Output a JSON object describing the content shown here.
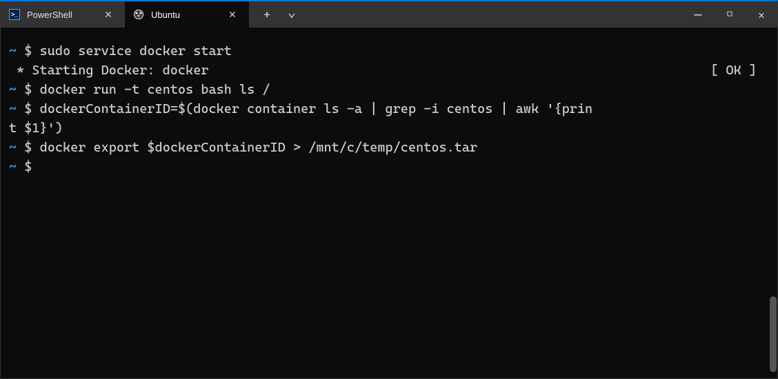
{
  "tabs": [
    {
      "title": "PowerShell",
      "active": false,
      "icon": "powershell"
    },
    {
      "title": "Ubuntu",
      "active": true,
      "icon": "ubuntu"
    }
  ],
  "terminal": {
    "prompt_tilde": "~",
    "prompt_dollar": "$",
    "lines": {
      "cmd1": "sudo service docker start",
      "output1_left": " * Starting Docker: docker",
      "output1_right": "[ OK ]",
      "cmd2": "docker run -t centos bash ls /",
      "cmd3a": "dockerContainerID=$(docker container ls -a | grep -i centos | awk '{prin",
      "cmd3b": "t $1}')",
      "cmd4": "docker export $dockerContainerID > /mnt/c/temp/centos.tar",
      "cmd5": ""
    }
  },
  "icons": {
    "close_glyph": "✕",
    "plus_glyph": "+",
    "chevron_glyph": "⌄",
    "minimize_glyph": "─",
    "maximize_glyph": "□"
  }
}
